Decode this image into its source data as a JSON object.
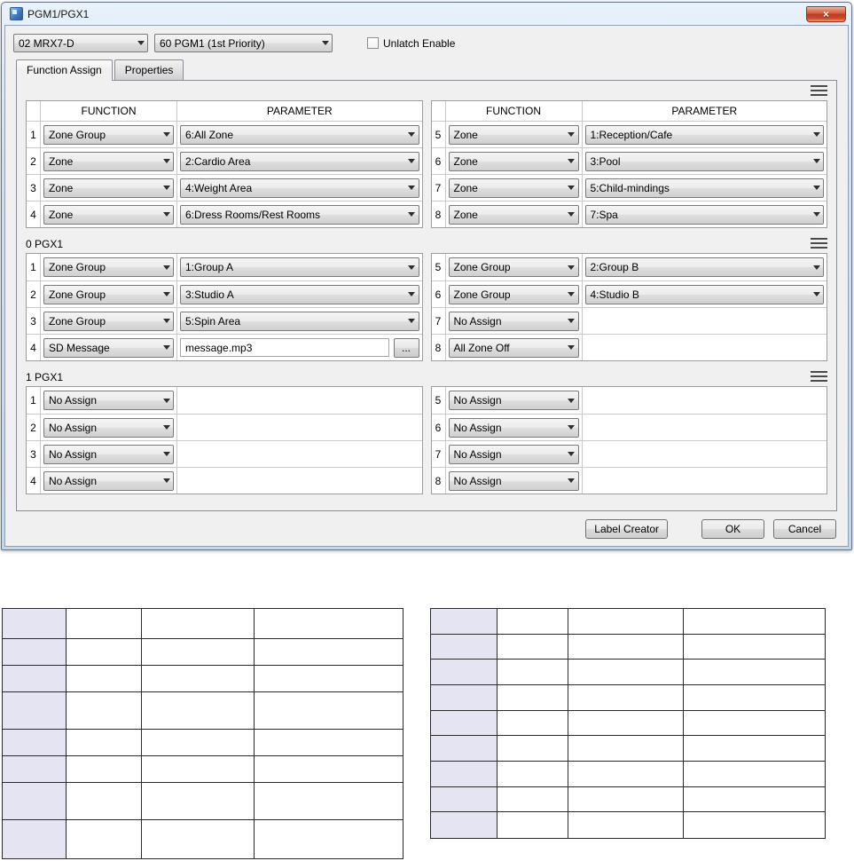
{
  "window": {
    "title": "PGM1/PGX1"
  },
  "icons": {
    "close": "×"
  },
  "toolbar": {
    "device_select": "02 MRX7-D",
    "priority_select": "60 PGM1 (1st Priority)",
    "unlatch_label": "Unlatch Enable"
  },
  "tabs": [
    {
      "label": "Function Assign"
    },
    {
      "label": "Properties"
    }
  ],
  "table_headers": {
    "function": "FUNCTION",
    "parameter": "PARAMETER"
  },
  "sections": [
    {
      "label": "",
      "has_header": true,
      "rows": [
        {
          "num": "1",
          "function": "Zone Group",
          "parameter": "6:All Zone",
          "ptype": "combo"
        },
        {
          "num": "2",
          "function": "Zone",
          "parameter": "2:Cardio Area",
          "ptype": "combo"
        },
        {
          "num": "3",
          "function": "Zone",
          "parameter": "4:Weight Area",
          "ptype": "combo"
        },
        {
          "num": "4",
          "function": "Zone",
          "parameter": "6:Dress Rooms/Rest Rooms",
          "ptype": "combo"
        },
        {
          "num": "5",
          "function": "Zone",
          "parameter": "1:Reception/Cafe",
          "ptype": "combo"
        },
        {
          "num": "6",
          "function": "Zone",
          "parameter": "3:Pool",
          "ptype": "combo"
        },
        {
          "num": "7",
          "function": "Zone",
          "parameter": "5:Child-mindings",
          "ptype": "combo"
        },
        {
          "num": "8",
          "function": "Zone",
          "parameter": "7:Spa",
          "ptype": "combo"
        }
      ]
    },
    {
      "label": "0 PGX1",
      "has_header": false,
      "rows": [
        {
          "num": "1",
          "function": "Zone Group",
          "parameter": "1:Group A",
          "ptype": "combo"
        },
        {
          "num": "2",
          "function": "Zone Group",
          "parameter": "3:Studio A",
          "ptype": "combo"
        },
        {
          "num": "3",
          "function": "Zone Group",
          "parameter": "5:Spin Area",
          "ptype": "combo"
        },
        {
          "num": "4",
          "function": "SD Message",
          "parameter": "message.mp3",
          "ptype": "file",
          "browse_label": "..."
        },
        {
          "num": "5",
          "function": "Zone Group",
          "parameter": "2:Group B",
          "ptype": "combo"
        },
        {
          "num": "6",
          "function": "Zone Group",
          "parameter": "4:Studio B",
          "ptype": "combo"
        },
        {
          "num": "7",
          "function": "No Assign",
          "parameter": "",
          "ptype": "empty"
        },
        {
          "num": "8",
          "function": "All Zone Off",
          "parameter": "",
          "ptype": "empty"
        }
      ]
    },
    {
      "label": "1 PGX1",
      "has_header": false,
      "rows": [
        {
          "num": "1",
          "function": "No Assign",
          "parameter": "",
          "ptype": "empty"
        },
        {
          "num": "2",
          "function": "No Assign",
          "parameter": "",
          "ptype": "empty"
        },
        {
          "num": "3",
          "function": "No Assign",
          "parameter": "",
          "ptype": "empty"
        },
        {
          "num": "4",
          "function": "No Assign",
          "parameter": "",
          "ptype": "empty"
        },
        {
          "num": "5",
          "function": "No Assign",
          "parameter": "",
          "ptype": "empty"
        },
        {
          "num": "6",
          "function": "No Assign",
          "parameter": "",
          "ptype": "empty"
        },
        {
          "num": "7",
          "function": "No Assign",
          "parameter": "",
          "ptype": "empty"
        },
        {
          "num": "8",
          "function": "No Assign",
          "parameter": "",
          "ptype": "empty"
        }
      ]
    }
  ],
  "footer": {
    "label_creator": "Label Creator",
    "ok": "OK",
    "cancel": "Cancel"
  },
  "label_tables": [
    {
      "rows": 8,
      "cols": 4
    },
    {
      "rows": 9,
      "cols": 4
    }
  ],
  "colors": {
    "close_button": "#c8432b",
    "label_table_shade": "#e4e4f2",
    "dialog_frame": "#cfe0f1"
  }
}
